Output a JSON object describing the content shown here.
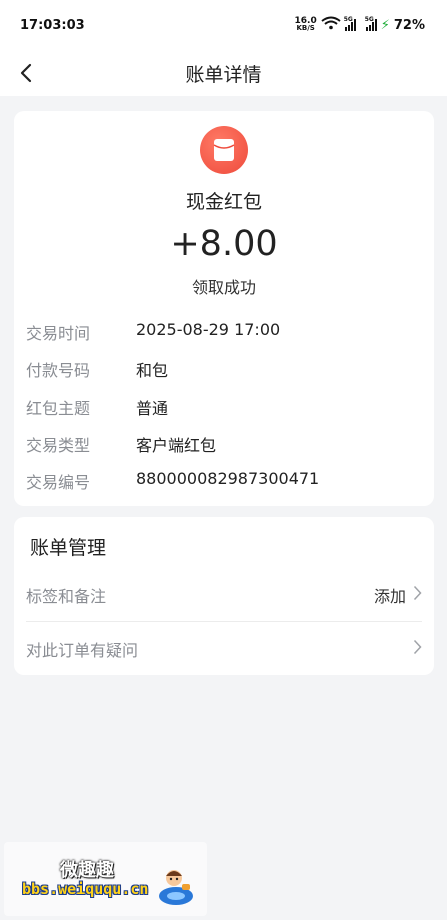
{
  "status_bar": {
    "time": "17:03:03",
    "net_speed_value": "16.0",
    "net_speed_unit": "KB/S",
    "signal1_tag": "5G",
    "signal2_tag": "5G",
    "battery": "72%"
  },
  "nav": {
    "title": "账单详情"
  },
  "bill": {
    "name": "现金红包",
    "amount": "+8.00",
    "status": "领取成功",
    "details": [
      {
        "label": "交易时间",
        "value": "2025-08-29 17:00"
      },
      {
        "label": "付款号码",
        "value": "和包"
      },
      {
        "label": "红包主题",
        "value": "普通"
      },
      {
        "label": "交易类型",
        "value": "客户端红包"
      },
      {
        "label": "交易编号",
        "value": "880000082987300471"
      }
    ]
  },
  "manage": {
    "title": "账单管理",
    "rows": [
      {
        "label": "标签和备注",
        "value": "添加"
      },
      {
        "label": "对此订单有疑问",
        "value": ""
      }
    ]
  },
  "watermark": {
    "text_cn": "微趣趣",
    "url": "bbs.weiququ.cn"
  },
  "colors": {
    "accent_red": "#ee4a3b",
    "label_gray": "#8a8d93",
    "page_bg": "#f3f4f6"
  }
}
